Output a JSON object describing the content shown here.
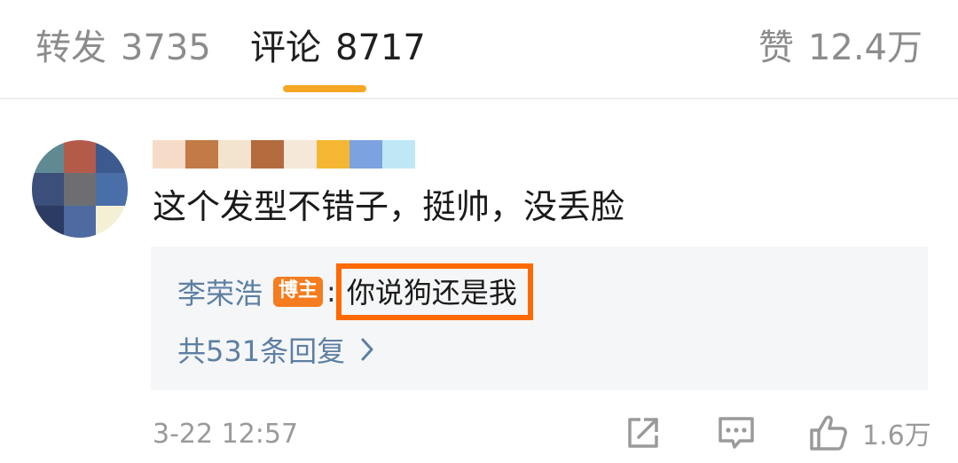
{
  "tabs": {
    "repost": {
      "label": "转发",
      "count": "3735"
    },
    "comment": {
      "label": "评论",
      "count": "8717"
    },
    "like": {
      "label": "赞",
      "count": "12.4万"
    },
    "active_color": "#f5a623"
  },
  "comment": {
    "text": "这个发型不错子，挺帅，没丢脸",
    "timestamp": "3-22 12:57",
    "like_count": "1.6万",
    "avatar_pixel_colors": [
      "#5f8a93",
      "#b45a4a",
      "#3c5a8e",
      "#3b4f7a",
      "#6e6e72",
      "#4a6fa8",
      "#2c3b62",
      "#4e6aa0",
      "#f4f0d6"
    ],
    "username_pixel_colors": [
      "#f6dcc8",
      "#c27a46",
      "#f3e4d0",
      "#b36b3e",
      "#f6e8d8",
      "#f5b733",
      "#7da2e0",
      "#bfe7f5"
    ]
  },
  "reply": {
    "author": "李荣浩",
    "badge": "博主",
    "colon": ":",
    "text": "你说狗还是我",
    "more": "共531条回复",
    "highlight_color": "#ff6a00"
  },
  "icons": {
    "share": "share-icon",
    "comment": "comment-icon",
    "like": "thumbs-up-icon",
    "chevron": "chevron-right-icon"
  }
}
